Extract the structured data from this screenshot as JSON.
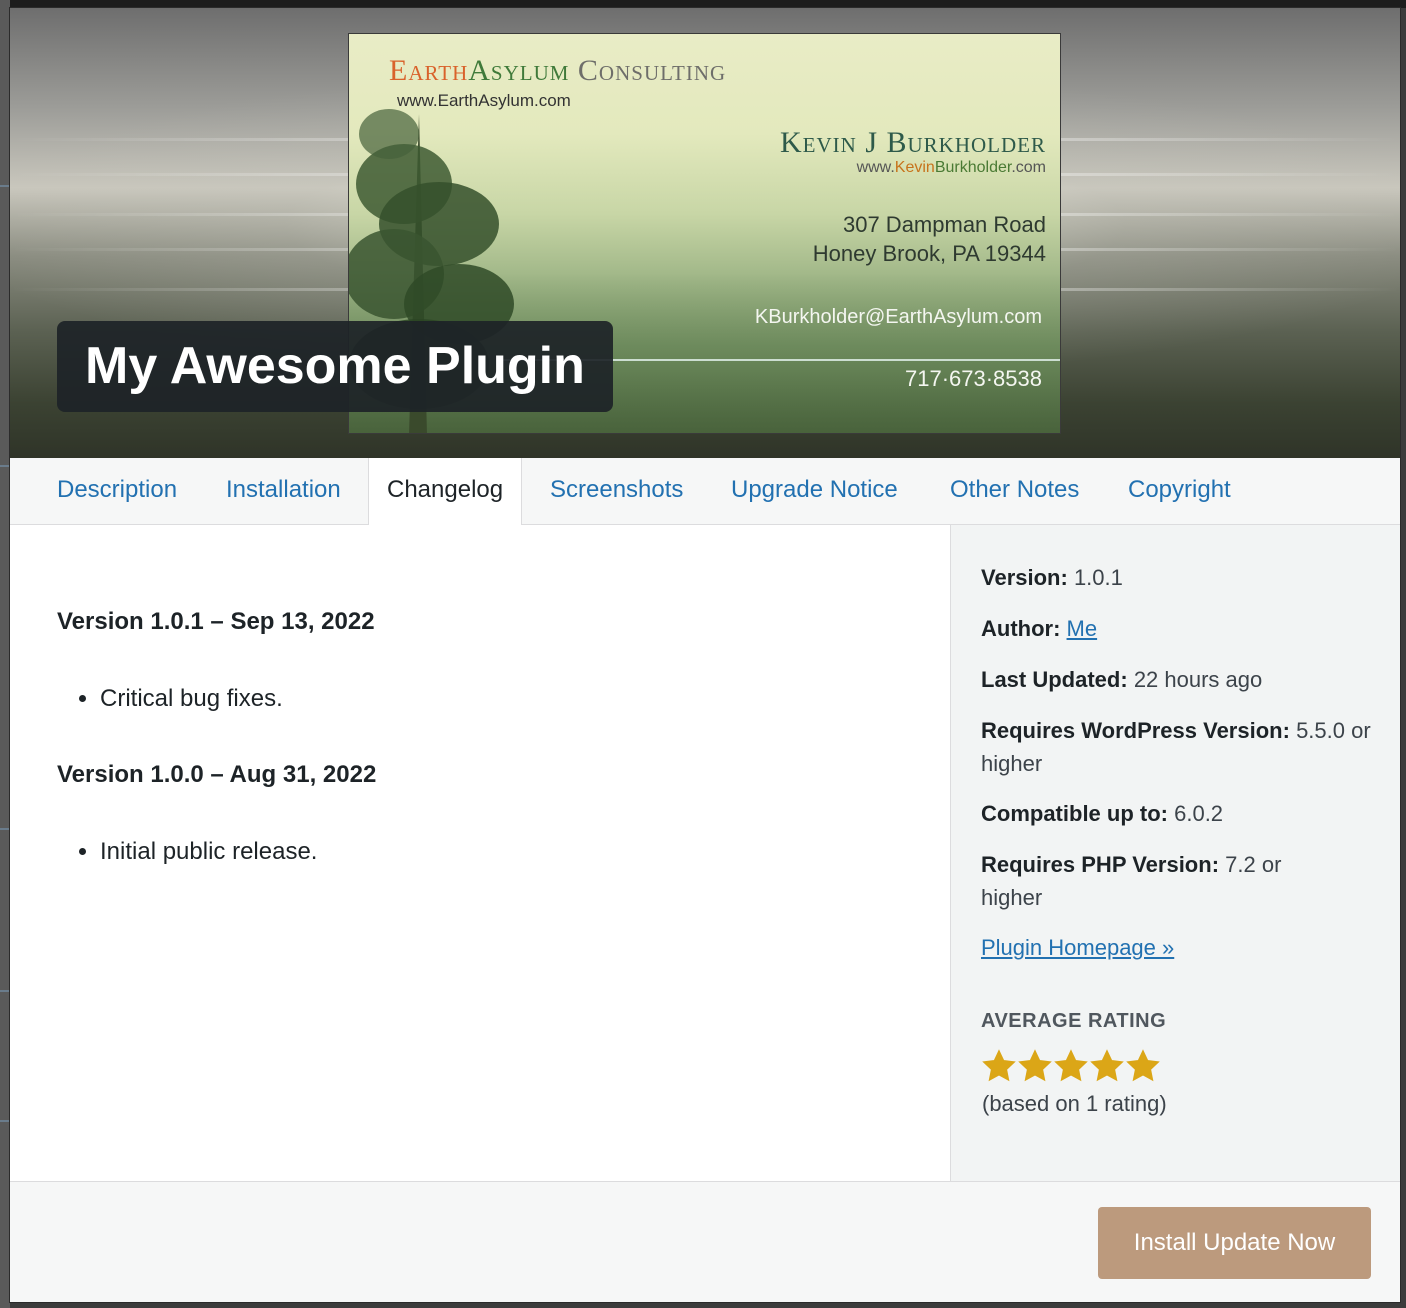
{
  "banner": {
    "plugin_title": "My Awesome Plugin",
    "card": {
      "brand_earth": "Earth",
      "brand_asylum": "Asylum",
      "brand_consulting": " Consulting",
      "url": "www.EarthAsylum.com",
      "name": "Kevin J Burkholder",
      "site_prefix": "www.",
      "site_kevin": "Kevin",
      "site_burkholder": "Burkholder",
      "site_suffix": ".com",
      "address_line1": "307 Dampman Road",
      "address_line2": "Honey Brook, PA 19344",
      "email": "KBurkholder@EarthAsylum.com",
      "phone": "717·673·8538"
    }
  },
  "tabs": [
    {
      "label": "Description",
      "active": false
    },
    {
      "label": "Installation",
      "active": false
    },
    {
      "label": "Changelog",
      "active": true
    },
    {
      "label": "Screenshots",
      "active": false
    },
    {
      "label": "Upgrade Notice",
      "active": false
    },
    {
      "label": "Other Notes",
      "active": false
    },
    {
      "label": "Copyright",
      "active": false
    }
  ],
  "changelog": [
    {
      "heading": "Version 1.0.1 – Sep 13, 2022",
      "items": [
        "Critical bug fixes."
      ]
    },
    {
      "heading": "Version 1.0.0 – Aug 31, 2022",
      "items": [
        "Initial public release."
      ]
    }
  ],
  "sidebar": {
    "version_label": "Version:",
    "version_value": "1.0.1",
    "author_label": "Author:",
    "author_value": "Me",
    "updated_label": "Last Updated:",
    "updated_value": "22 hours ago",
    "requires_wp_label": "Requires WordPress Version:",
    "requires_wp_value": "5.5.0 or higher",
    "compatible_label": "Compatible up to:",
    "compatible_value": "6.0.2",
    "requires_php_label": "Requires PHP Version:",
    "requires_php_value": "7.2 or higher",
    "homepage_link": "Plugin Homepage »",
    "rating_heading": "AVERAGE RATING",
    "rating_stars": 5,
    "rating_max": 5,
    "rating_note": "(based on 1 rating)"
  },
  "footer": {
    "install_button": "Install Update Now"
  },
  "colors": {
    "link": "#2271b1",
    "star": "#dba617",
    "button": "#bc9a7d",
    "title_bg": "#1d2327"
  },
  "icons": {
    "star": "star-icon"
  }
}
